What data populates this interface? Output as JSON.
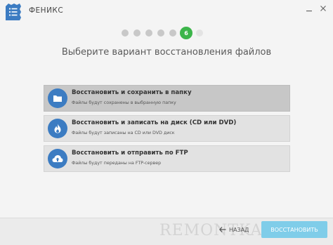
{
  "window": {
    "title": "ФЕНИКС",
    "app_icon": "menu-list-icon",
    "controls": [
      "minimize-icon",
      "close-icon"
    ]
  },
  "stepper": {
    "total_steps": 7,
    "current_step": 6,
    "current_label": "6"
  },
  "page": {
    "title": "Выберите вариант восстановления файлов"
  },
  "options": [
    {
      "title": "Восстановить и сохранить в папку",
      "subtitle": "Файлы будут сохранены в выбранную папку",
      "icon": "folder-icon",
      "selected": true
    },
    {
      "title": "Восстановить и записать на диск (CD или DVD)",
      "subtitle": "Файлы будут записаны на CD или DVD диск",
      "icon": "fire-icon",
      "selected": false
    },
    {
      "title": "Восстановить и отправить по FTP",
      "subtitle": "Файлы будут переданы на FTP-сервер",
      "icon": "cloud-upload-icon",
      "selected": false
    }
  ],
  "footer": {
    "back_label": "НАЗАД",
    "next_label": "ВОССТАНОВИТЬ",
    "watermark": "REMONTKA.COM"
  },
  "colors": {
    "accent_green": "#3cb54a",
    "accent_blue": "#3c7cc2",
    "next_button": "#7fcde9",
    "selected_option": "#c7c7c7",
    "option": "#e2e2e2"
  }
}
